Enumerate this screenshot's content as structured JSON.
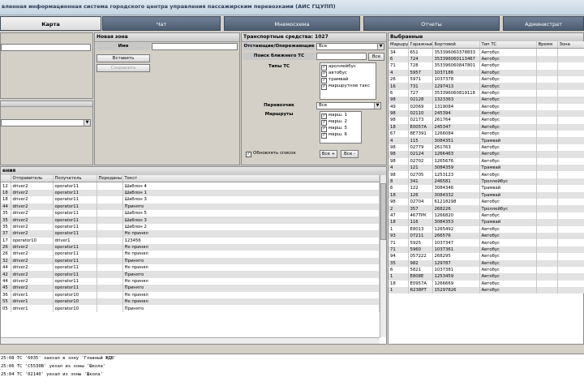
{
  "app": {
    "title": "вленная информационная система городского центра управления пассажирским перевозками (АИС ГЦУПП)"
  },
  "tabs": [
    "Карта",
    "Чат",
    "Мнемосхема",
    "Отчеты",
    "Администрат"
  ],
  "new_zone": {
    "header": "Новая зона",
    "name_label": "Имя",
    "name_value": "",
    "draw_button": "Вставить",
    "save_button": "Сохранить"
  },
  "vehicles": {
    "header": "Транспортные средства: 1027",
    "tracked_label": "Отстающие/Опережающие",
    "tracked_value": "Все",
    "nearest_label": "Поиск ближнего ТС",
    "nearest_value": "",
    "nearest_button": "Все",
    "types_label": "Типы ТС",
    "types": [
      "ароллейбус",
      "автобус",
      "трамвай",
      "маршрутное такс"
    ],
    "carrier_label": "Перевозчик",
    "carrier_value": "Все",
    "routes_label": "Маршруты",
    "routes": [
      "марш. 1",
      "марш. 2",
      "марш. 5",
      "марш. 6"
    ],
    "refresh_label": "Обновлять список",
    "all_plus": "Все +",
    "all_minus": "Все -"
  },
  "messages": {
    "header": "ения",
    "columns": [
      "",
      "Отправитель",
      "Получатель",
      "Переданы",
      "Текст"
    ],
    "rows": [
      [
        "12",
        "driver2",
        "operator11",
        "",
        "Шаблон 4"
      ],
      [
        "18",
        "driver2",
        "operator11",
        "",
        "Шаблон 1"
      ],
      [
        "18",
        "driver2",
        "operator11",
        "",
        "Шаблон 3"
      ],
      [
        "44",
        "driver2",
        "operator11",
        "",
        "Принято"
      ],
      [
        "35",
        "driver2",
        "operator11",
        "",
        "Шаблон 5"
      ],
      [
        "35",
        "driver2",
        "operator11",
        "",
        "Шаблон 3"
      ],
      [
        "35",
        "driver2",
        "operator11",
        "",
        "Шаблон 2"
      ],
      [
        "37",
        "driver2",
        "operator11",
        "",
        "Не принял"
      ],
      [
        "17",
        "operator10",
        "driver1",
        "",
        "123456"
      ],
      [
        "26",
        "driver2",
        "operator11",
        "",
        "Не принял"
      ],
      [
        "26",
        "driver2",
        "operator11",
        "",
        "Не принял"
      ],
      [
        "32",
        "driver2",
        "operator11",
        "",
        "Принято"
      ],
      [
        "44",
        "driver2",
        "operator11",
        "",
        "Не принял"
      ],
      [
        "42",
        "driver2",
        "operator11",
        "",
        "Принято"
      ],
      [
        "44",
        "driver2",
        "operator11",
        "",
        "Не принял"
      ],
      [
        "45",
        "driver2",
        "operator11",
        "",
        "Принято"
      ],
      [
        "36",
        "driver1",
        "operator10",
        "",
        "Не принял"
      ],
      [
        "55",
        "driver1",
        "operator10",
        "",
        "Не принял"
      ],
      [
        "05",
        "driver1",
        "operator10",
        "",
        "Принято"
      ]
    ]
  },
  "selected": {
    "header": "Выбранные",
    "columns": [
      "Маршрут",
      "Гаражный",
      "Бортовой",
      "Тип ТС",
      "Время",
      "Зона"
    ],
    "rows": [
      [
        "34",
        "651",
        "353396060378833",
        "Автобус"
      ],
      [
        "6",
        "724",
        "353396060113467",
        "Автобус"
      ],
      [
        "71",
        "728",
        "353396060847801",
        "Автобус"
      ],
      [
        "4",
        "5957",
        "1037186",
        "Автобус"
      ],
      [
        "26",
        "5971",
        "1037378",
        "Автобус"
      ],
      [
        "16",
        "731",
        "1297413",
        "Автобус"
      ],
      [
        "6",
        "727",
        "353396060819118",
        "Автобус"
      ],
      [
        "98",
        "02128",
        "1323363",
        "Автобус"
      ],
      [
        "49",
        "02069",
        "1319084",
        "Автобус"
      ],
      [
        "98",
        "02110",
        "245394",
        "Автобус"
      ],
      [
        "98",
        "02173",
        "261764",
        "Автобус"
      ],
      [
        "18",
        "E0057A",
        "245347",
        "Автобус"
      ],
      [
        "67",
        "8E7391",
        "1266084",
        "Автобус"
      ],
      [
        "4",
        "115",
        "3084351",
        "Трамвай"
      ],
      [
        "98",
        "02779",
        "261763",
        "Автобус"
      ],
      [
        "98",
        "02124",
        "1266463",
        "Автобус"
      ],
      [
        "98",
        "02702",
        "1265676",
        "Автобус"
      ],
      [
        "4",
        "121",
        "3084359",
        "Трамвай"
      ],
      [
        "98",
        "02705",
        "1253123",
        "Автобус"
      ],
      [
        "8",
        "341",
        "246581",
        "Троллейбус"
      ],
      [
        "6",
        "122",
        "3084346",
        "Трамвай"
      ],
      [
        "18",
        "126",
        "3084332",
        "Трамвай"
      ],
      [
        "98",
        "02704",
        "61218298",
        "Автобус"
      ],
      [
        "2",
        "357",
        "268226",
        "Троллейбус"
      ],
      [
        "47",
        "467ТРК",
        "1266820",
        "Автобус"
      ],
      [
        "18",
        "116",
        "3084353",
        "Трамвай"
      ],
      [
        "1",
        "E8013",
        "1265492",
        "Автобус"
      ],
      [
        "93",
        "07211",
        "266576",
        "Автобус"
      ],
      [
        "71",
        "5925",
        "1037347",
        "Автобус"
      ],
      [
        "71",
        "5960",
        "1037361",
        "Автобус"
      ],
      [
        "94",
        "057222",
        "268295",
        "Автобус"
      ],
      [
        "35",
        "982",
        "129787",
        "Автобус"
      ],
      [
        "6",
        "5821",
        "1037381",
        "Автобус"
      ],
      [
        "1",
        "E808Е",
        "1253459",
        "Автобус"
      ],
      [
        "18",
        "E0957A",
        "1266669",
        "Автобус"
      ],
      [
        "1",
        "R238РТ",
        "15297826",
        "Автобус"
      ]
    ]
  },
  "log": [
    "25:08 ТС '6035' заехал в зону 'Главный ЖДВ'",
    "25:06 ТС 'С5530В' уехал из зоны 'Школа'",
    "25:04 ТС '02140' уехал из зоны 'Школа'"
  ]
}
